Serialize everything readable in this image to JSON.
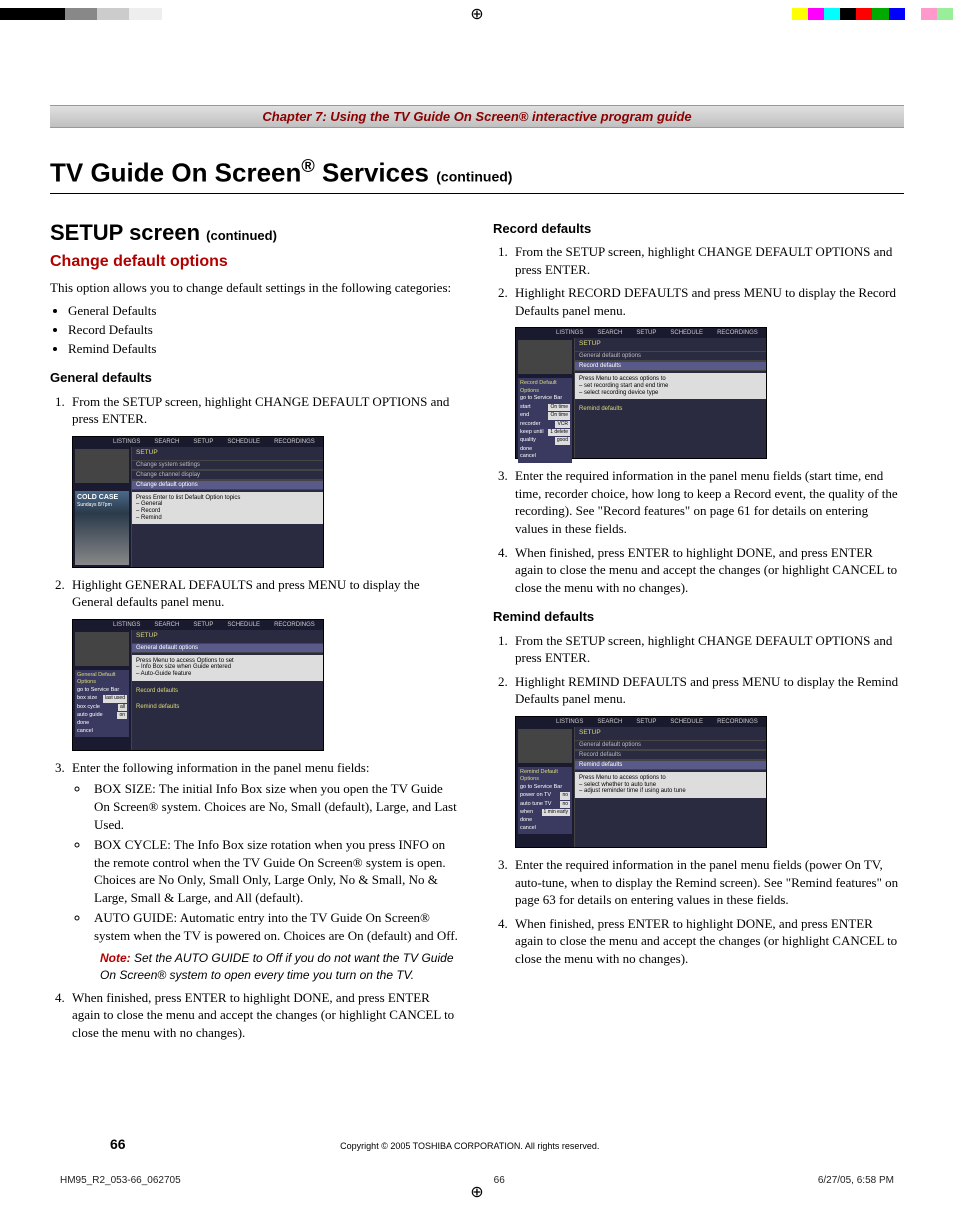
{
  "reg_mark": "⊕",
  "color_bar": [
    "#000",
    "#000",
    "#000",
    "#000",
    "#888",
    "#888",
    "#ccc",
    "#ccc",
    "#eee",
    "#eee",
    "transparent",
    "transparent",
    "transparent",
    "transparent",
    "transparent",
    "transparent",
    "transparent",
    "transparent",
    "transparent",
    "transparent",
    "transparent",
    "transparent",
    "transparent",
    "transparent",
    "transparent",
    "transparent",
    "transparent",
    "transparent",
    "transparent",
    "transparent",
    "transparent",
    "transparent",
    "transparent",
    "transparent",
    "transparent",
    "transparent",
    "transparent",
    "transparent",
    "transparent",
    "transparent",
    "transparent",
    "transparent",
    "transparent",
    "transparent",
    "transparent",
    "transparent",
    "transparent",
    "transparent",
    "transparent",
    "#ffff00",
    "#ff00ff",
    "#00ffff",
    "#000",
    "#ff0000",
    "#00aa00",
    "#0000ff",
    "#fff",
    "#ff99cc",
    "#99ee99"
  ],
  "chapter_line": "Chapter 7: Using the TV Guide On Screen® interactive program guide",
  "title_main": "TV Guide On Screen",
  "title_reg": "®",
  "title_sub": " Services ",
  "title_cont": "(continued)",
  "left": {
    "setup_heading": "SETUP screen",
    "setup_cont": "(continued)",
    "change_heading": "Change default options",
    "intro": "This option allows you to change default settings in the following categories:",
    "bullets": [
      "General Defaults",
      "Record Defaults",
      "Remind Defaults"
    ],
    "general_heading": "General defaults",
    "general_steps": {
      "s1": "From the SETUP screen, highlight CHANGE DEFAULT OPTIONS and press ENTER.",
      "s2": "Highlight GENERAL DEFAULTS and press MENU to display the General defaults panel menu.",
      "s3": "Enter the following information in the panel menu fields:",
      "s3_bullets": {
        "b1": "BOX SIZE: The initial Info Box size when you open the TV Guide On Screen® system. Choices are No, Small (default), Large, and Last Used.",
        "b2": "BOX CYCLE: The Info Box size rotation when you press INFO on the remote control when the TV Guide On Screen® system is open. Choices are No Only, Small Only, Large Only, No & Small, No & Large, Small & Large, and All (default).",
        "b3": "AUTO GUIDE: Automatic entry into the TV Guide On Screen® system when the TV is powered on. Choices are On (default) and Off."
      },
      "note_label": "Note:",
      "note_text": " Set the AUTO GUIDE to Off if you do not want the TV Guide On Screen® system to open every time you turn on the TV.",
      "s4": "When finished, press ENTER to highlight DONE, and press ENTER again to close the menu and accept the changes (or highlight CANCEL to close the menu with no changes)."
    },
    "ss1": {
      "tabs": [
        "LISTINGS",
        "SEARCH",
        "SETUP",
        "SCHEDULE",
        "RECORDINGS"
      ],
      "header": "SETUP",
      "lines": [
        "Change system settings",
        "Change channel display",
        "Change default options"
      ],
      "info": "Press Enter to list Default Option topics\n– General\n– Record\n– Remind",
      "show_title": "COLD CASE",
      "show_meta": "Sundays 8/7pm"
    },
    "ss2": {
      "tabs": [
        "LISTINGS",
        "SEARCH",
        "SETUP",
        "SCHEDULE",
        "RECORDINGS"
      ],
      "header": "SETUP",
      "line1": "General default options",
      "info": "Press Menu to access Options to set\n– Info Box size when Guide entered\n– Auto-Guide feature",
      "panel_title": "General Default Options",
      "panel_sub": "go to Service Bar",
      "rows": [
        {
          "label": "box size",
          "value": "last used"
        },
        {
          "label": "box cycle",
          "value": "all"
        },
        {
          "label": "auto guide",
          "value": "on"
        }
      ],
      "done": "done",
      "cancel": "cancel",
      "section_rec": "Record defaults",
      "section_rem": "Remind defaults"
    }
  },
  "right": {
    "record_heading": "Record defaults",
    "record_steps": {
      "s1": "From the SETUP screen, highlight CHANGE DEFAULT OPTIONS and press ENTER.",
      "s2": "Highlight RECORD DEFAULTS and press MENU to display the Record Defaults panel menu.",
      "s3": "Enter the required information in the panel menu fields (start time, end time, recorder choice, how long to keep a Record event, the quality of the recording). See \"Record features\" on page 61 for details on entering values in these fields.",
      "s4": "When finished, press ENTER to highlight DONE, and press ENTER again to close the menu and accept the changes (or highlight CANCEL to close the menu with no changes)."
    },
    "ss3": {
      "tabs": [
        "LISTINGS",
        "SEARCH",
        "SETUP",
        "SCHEDULE",
        "RECORDINGS"
      ],
      "header": "SETUP",
      "line1": "General default options",
      "line2": "Record defaults",
      "info": "Press Menu to access options to\n– set recording start and end time\n– select recording device type",
      "panel_title": "Record Default Options",
      "panel_sub": "go to Service Bar",
      "rows": [
        {
          "label": "start",
          "value": "On time"
        },
        {
          "label": "end",
          "value": "On time"
        },
        {
          "label": "recorder",
          "value": "VCR"
        },
        {
          "label": "keep until",
          "value": "1 delete"
        },
        {
          "label": "quality",
          "value": "good"
        }
      ],
      "done": "done",
      "cancel": "cancel",
      "section_rem": "Remind defaults"
    },
    "remind_heading": "Remind defaults",
    "remind_steps": {
      "s1": "From the SETUP screen, highlight CHANGE DEFAULT OPTIONS and press ENTER.",
      "s2": "Highlight REMIND DEFAULTS and press MENU to display the Remind Defaults panel menu.",
      "s3": "Enter the required information in the panel menu fields (power On TV, auto-tune, when to display the Remind screen). See \"Remind features\" on page 63 for details on entering values in these fields.",
      "s4": "When finished, press ENTER to highlight DONE, and press ENTER again to close the menu and accept the changes (or highlight CANCEL to close the menu with no changes)."
    },
    "ss4": {
      "tabs": [
        "LISTINGS",
        "SEARCH",
        "SETUP",
        "SCHEDULE",
        "RECORDINGS"
      ],
      "header": "SETUP",
      "line1": "General default options",
      "line2": "Record defaults",
      "line3": "Remind defaults",
      "info": "Press Menu to access options to\n– select whether to auto tune\n– adjust reminder time if using auto tune",
      "panel_title": "Remind Default Options",
      "panel_sub": "go to Service Bar",
      "rows": [
        {
          "label": "power on TV",
          "value": "no"
        },
        {
          "label": "auto tune TV",
          "value": "no"
        },
        {
          "label": "when",
          "value": "1 min early"
        }
      ],
      "done": "done",
      "cancel": "cancel"
    }
  },
  "footer": {
    "page_num": "66",
    "copyright": "Copyright © 2005 TOSHIBA CORPORATION. All rights reserved.",
    "doc_id": "HM95_R2_053-66_062705",
    "page_mid": "66",
    "timestamp": "6/27/05, 6:58 PM"
  }
}
